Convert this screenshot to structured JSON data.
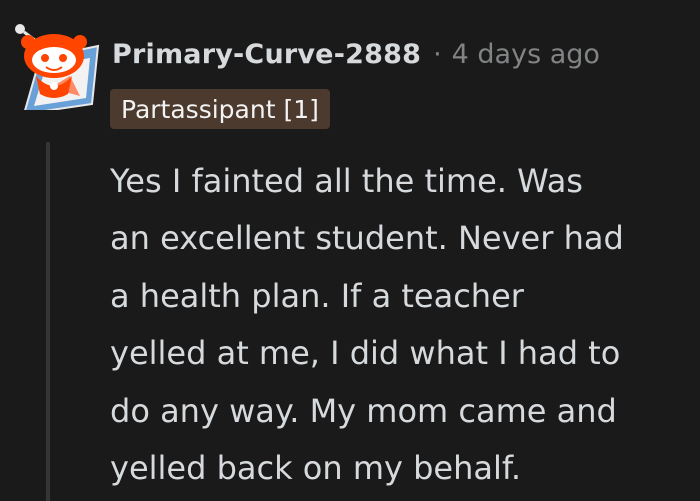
{
  "comment": {
    "author": "Primary-Curve-2888",
    "separator": "·",
    "timestamp": "4 days ago",
    "flair": "Partassipant [1]",
    "body": "Yes I fainted all the time. Was\nan excellent student. Never had\na health plan. If a teacher\nyelled at me, I did what I had to\ndo any way. My mom came and\nyelled back on my behalf."
  },
  "colors": {
    "background": "#1a1a1b",
    "text": "#d7dadc",
    "meta": "#818384",
    "flair_background": "#4c3a2e",
    "thread_line": "#343536",
    "avatar_accent": "#ff4500"
  },
  "icons": {
    "avatar": "snoo-avatar-icon"
  }
}
